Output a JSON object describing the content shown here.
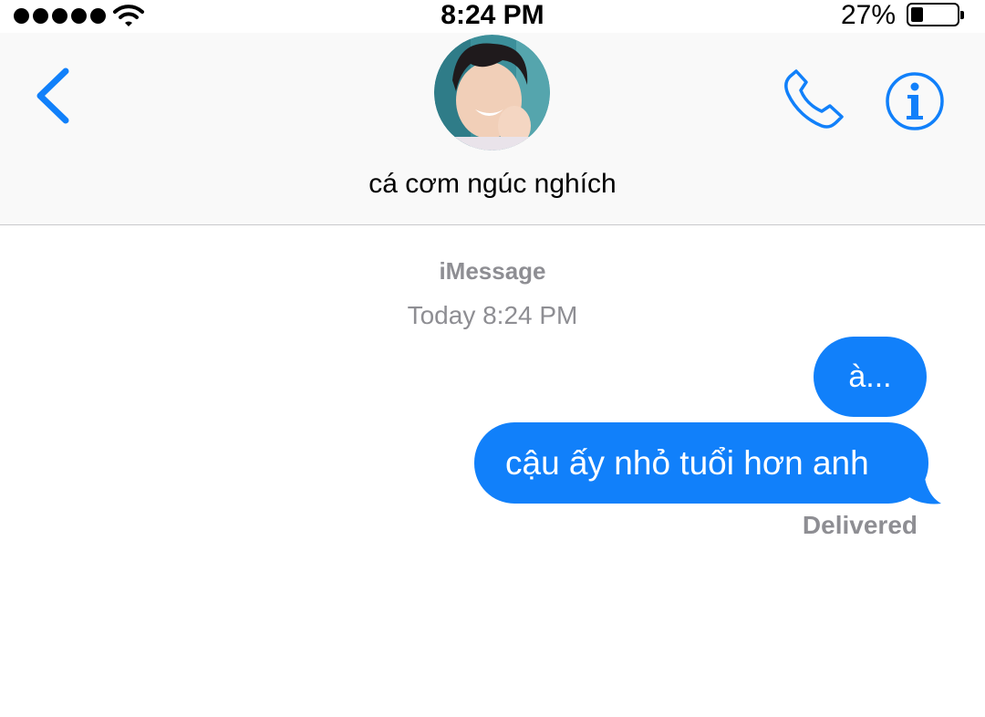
{
  "status_bar": {
    "time": "8:24 PM",
    "battery_percent": "27%",
    "battery_level": 0.27,
    "signal_bars": 5
  },
  "header": {
    "contact_name": "cá cơm ngúc nghích",
    "icons": [
      "back-chevron-icon",
      "phone-icon",
      "info-icon"
    ]
  },
  "conversation": {
    "service_label": "iMessage",
    "timestamp": "Today 8:24 PM",
    "messages": [
      {
        "text": "à...",
        "direction": "outgoing"
      },
      {
        "text": "cậu ấy nhỏ tuổi hơn anh",
        "direction": "outgoing"
      }
    ],
    "delivery_status": "Delivered"
  },
  "colors": {
    "accent": "#1180fa",
    "secondary_text": "#8e8e93",
    "header_bg": "#f9f9f9"
  }
}
